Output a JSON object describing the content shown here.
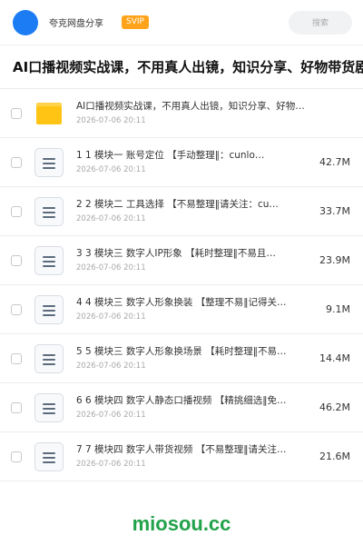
{
  "header": {
    "user_name": "夸克网盘分享",
    "vip_badge": "SVIP",
    "search_placeholder": "搜索"
  },
  "title": "AI口播视频实战课，不用真人出镜，知识分享、好物带货剧",
  "files": [
    {
      "type": "folder",
      "name": "AI口播视频实战课，不用真人出镜，知识分享、好物带…",
      "date": "2026-07-06 20:11",
      "size": ""
    },
    {
      "type": "file",
      "name": "1 1 模块一 账号定位 【手动整理‖：cunlo…",
      "date": "2026-07-06 20:11",
      "size": "42.7M"
    },
    {
      "type": "file",
      "name": "2 2 模块二 工具选择 【不易整理‖请关注：cu…",
      "date": "2026-07-06 20:11",
      "size": "33.7M"
    },
    {
      "type": "file",
      "name": "3 3 模块三 数字人IP形象 【耗时整理‖不易且…",
      "date": "2026-07-06 20:11",
      "size": "23.9M"
    },
    {
      "type": "file",
      "name": "4 4 模块三 数字人形象换装 【整理不易‖记得关…",
      "date": "2026-07-06 20:11",
      "size": "9.1M"
    },
    {
      "type": "file",
      "name": "5 5 模块三 数字人形象换场景 【耗时整理‖不易…",
      "date": "2026-07-06 20:11",
      "size": "14.4M"
    },
    {
      "type": "file",
      "name": "6 6 模块四 数字人静态口播视频 【精挑细选‖免…",
      "date": "2026-07-06 20:11",
      "size": "46.2M"
    },
    {
      "type": "file",
      "name": "7 7 模块四 数字人带货视频 【不易整理‖请关注…",
      "date": "2026-07-06 20:11",
      "size": "21.6M"
    }
  ],
  "watermark": "miosou.cc",
  "colors": {
    "accent": "#1c7cf4",
    "vip": "#ffa31a",
    "folder": "#ffc414",
    "watermark": "#21a24a"
  }
}
